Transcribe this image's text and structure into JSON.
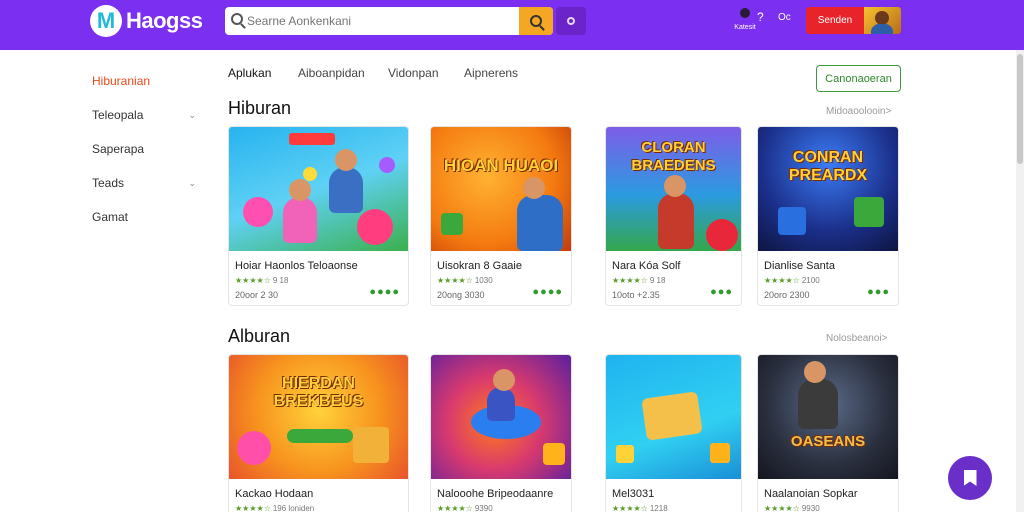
{
  "header": {
    "logo_letter": "M",
    "logo_text": "Haogss",
    "search_placeholder": "Searne Aonkenkani",
    "account_label": "Katesit",
    "help_icon": "?",
    "language_label": "Oc",
    "cta_label": "Senden",
    "brand_color": "#7b2ff0",
    "search_button_color": "#f5a623",
    "cta_color": "#e8242a"
  },
  "sidebar": {
    "items": [
      {
        "label": "Hiburanian",
        "active": true,
        "has_chevron": false
      },
      {
        "label": "Teleopala",
        "active": false,
        "has_chevron": true
      },
      {
        "label": "Saperapa",
        "active": false,
        "has_chevron": false
      },
      {
        "label": "Teads",
        "active": false,
        "has_chevron": true
      },
      {
        "label": "Gamat",
        "active": false,
        "has_chevron": false
      }
    ],
    "active_color": "#e84a1a"
  },
  "tabs": [
    {
      "label": "Aplukan",
      "active": true
    },
    {
      "label": "Aiboanpidan",
      "active": false
    },
    {
      "label": "Vidonpan",
      "active": false
    },
    {
      "label": "Aipnerens",
      "active": false
    }
  ],
  "category_button": "Canonaoeran",
  "sections": [
    {
      "title": "Hiburan",
      "see_more": "Midoaoolooin>",
      "cards": [
        {
          "name": "Hoiar Haonlos Teloaonse",
          "rating": "★★★★☆",
          "rating_text": "9 18",
          "meta": "20oor 2 30",
          "thumb_text": "",
          "dots": "●●●●"
        },
        {
          "name": "Uisokran 8 Gaaie",
          "rating": "★★★★☆",
          "rating_text": "1030",
          "meta": "20ong 3030",
          "thumb_text": "HIOAN HUAOI",
          "dots": "●●●●"
        },
        {
          "name": "Nara Kóa Solf",
          "rating": "★★★★☆",
          "rating_text": "9 18",
          "meta": "10oto +2.35",
          "thumb_text": "CLORAN BRAEDENS",
          "dots": "●●●"
        },
        {
          "name": "Dianlise Santa",
          "rating": "★★★★☆",
          "rating_text": "2100",
          "meta": "20oro 2300",
          "thumb_text": "CONRAN PREARDX",
          "dots": "●●●"
        }
      ]
    },
    {
      "title": "Alburan",
      "see_more": "Nolosbeanoi>",
      "cards": [
        {
          "name": "Kackao Hodaan",
          "rating": "★★★★☆",
          "rating_text": "196 loniden",
          "meta": "",
          "thumb_text": "HIERDAN BREKBEUS",
          "dots": "●●●"
        },
        {
          "name": "Nalooohe Bripeodaanre",
          "rating": "★★★★☆",
          "rating_text": "9390",
          "meta": "",
          "thumb_text": "",
          "dots": "●●●"
        },
        {
          "name": "Mel3031",
          "rating": "★★★★☆",
          "rating_text": "1218",
          "meta": "",
          "thumb_text": "",
          "dots": "●●●"
        },
        {
          "name": "Naalanoian Sopkar",
          "rating": "★★★★☆",
          "rating_text": "9930",
          "meta": "",
          "thumb_text": "OASEANS",
          "dots": ""
        }
      ]
    }
  ],
  "fab_icon": "bookmark-icon"
}
